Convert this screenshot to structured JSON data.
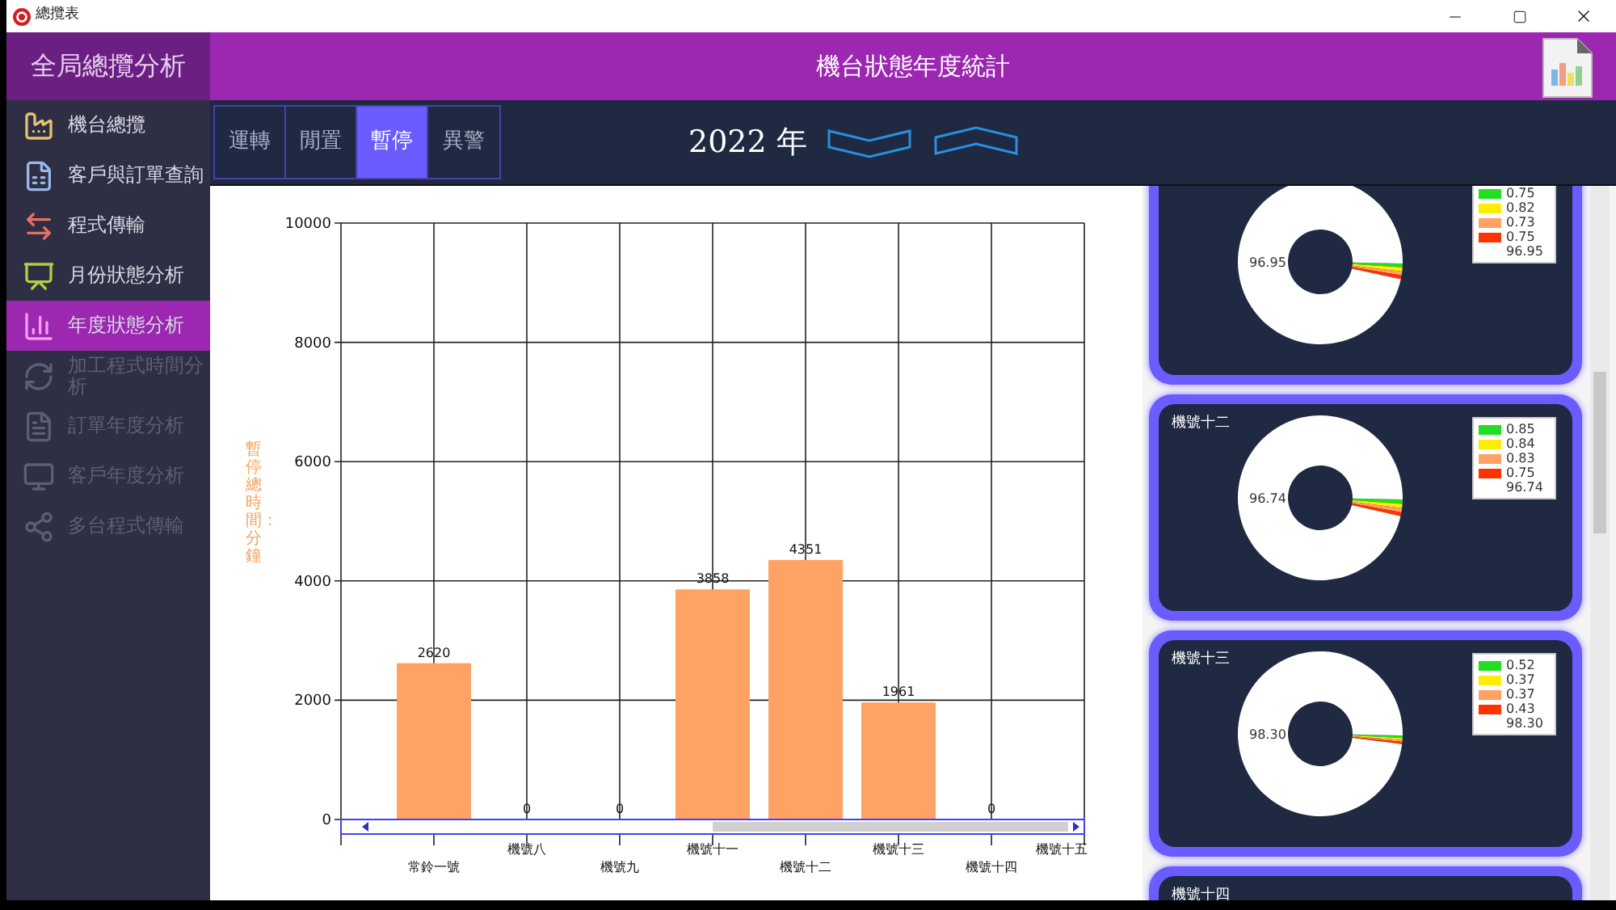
{
  "window": {
    "title": "總攬表"
  },
  "sidebar": {
    "title": "全局總攬分析",
    "items": [
      {
        "label": "機台總攬",
        "selected": false,
        "disabled": false
      },
      {
        "label": "客戶與訂單查詢",
        "selected": false,
        "disabled": false
      },
      {
        "label": "程式傳輸",
        "selected": false,
        "disabled": false
      },
      {
        "label": "月份狀態分析",
        "selected": false,
        "disabled": false
      },
      {
        "label": "年度狀態分析",
        "selected": true,
        "disabled": false
      },
      {
        "label": "加工程式時間分析",
        "selected": false,
        "disabled": true
      },
      {
        "label": "訂單年度分析",
        "selected": false,
        "disabled": true
      },
      {
        "label": "客戶年度分析",
        "selected": false,
        "disabled": true
      },
      {
        "label": "多台程式傳輸",
        "selected": false,
        "disabled": true
      }
    ]
  },
  "header": {
    "title": "機台狀態年度統計"
  },
  "tabs": [
    {
      "label": "運轉",
      "selected": false
    },
    {
      "label": "閒置",
      "selected": false
    },
    {
      "label": "暫停",
      "selected": true
    },
    {
      "label": "異警",
      "selected": false
    }
  ],
  "year": "2022 年",
  "bar_chart": {
    "chart_data": {
      "type": "bar",
      "ylabel": "暫停總時間：分鐘",
      "categories": [
        "常鈴一號",
        "機號八",
        "機號九",
        "機號十一",
        "機號十二",
        "機號十三",
        "機號十四",
        "機號十五"
      ],
      "series": [
        {
          "color": "#ffa263",
          "values": [
            2620,
            0,
            0,
            3858,
            4351,
            1961,
            0,
            null
          ]
        }
      ],
      "ylim": [
        0,
        10000
      ],
      "yticks": [
        0,
        2000,
        4000,
        6000,
        8000,
        10000
      ],
      "grid": true,
      "data_labels": true
    }
  },
  "cards": [
    {
      "donut_label": "96.95",
      "legend": [
        {
          "value": "0.75",
          "color": "#22dd22"
        },
        {
          "value": "0.82",
          "color": "#ffee00"
        },
        {
          "value": "0.73",
          "color": "#ffa263"
        },
        {
          "value": "0.75",
          "color": "#ff3300"
        },
        {
          "value": "96.95"
        }
      ],
      "chart_data": {
        "type": "donut",
        "values": [
          0.75,
          0.82,
          0.73,
          0.75,
          96.95
        ]
      }
    },
    {
      "title": "機號十二",
      "donut_label": "96.74",
      "legend": [
        {
          "value": "0.85",
          "color": "#22dd22"
        },
        {
          "value": "0.84",
          "color": "#ffee00"
        },
        {
          "value": "0.83",
          "color": "#ffa263"
        },
        {
          "value": "0.75",
          "color": "#ff3300"
        },
        {
          "value": "96.74"
        }
      ],
      "chart_data": {
        "type": "donut",
        "values": [
          0.85,
          0.84,
          0.83,
          0.75,
          96.74
        ]
      }
    },
    {
      "title": "機號十三",
      "donut_label": "98.30",
      "legend": [
        {
          "value": "0.52",
          "color": "#22dd22"
        },
        {
          "value": "0.37",
          "color": "#ffee00"
        },
        {
          "value": "0.37",
          "color": "#ffa263"
        },
        {
          "value": "0.43",
          "color": "#ff3300"
        },
        {
          "value": "98.30"
        }
      ],
      "chart_data": {
        "type": "donut",
        "values": [
          0.52,
          0.37,
          0.37,
          0.43,
          98.3
        ]
      }
    },
    {
      "title": "機號十四"
    }
  ]
}
